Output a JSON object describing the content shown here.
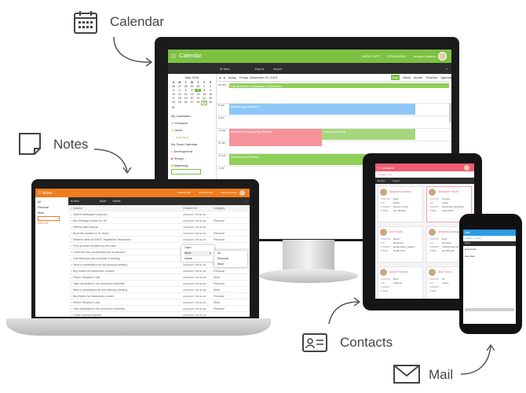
{
  "labels": {
    "calendar": "Calendar",
    "notes": "Notes",
    "contacts": "Contacts",
    "mail": "Mail"
  },
  "colors": {
    "calendar": "#7cc142",
    "notes": "#f07c1e",
    "contacts": "#f25d72",
    "mail": "#2d9be6",
    "blue_event": "#8ec7f5",
    "red_event": "#f6939a"
  },
  "calendar": {
    "title": "Calendar",
    "about": "ABOUT APP",
    "download": "DOWNLOAD",
    "user": "Antonio Moreno",
    "toolbar": {
      "new": "New",
      "export": "Export",
      "import": "Import"
    },
    "month": "May 2015",
    "weekdays": [
      "S",
      "M",
      "T",
      "W",
      "T",
      "F",
      "S"
    ],
    "days": [
      "26",
      "27",
      "28",
      "29",
      "30",
      "1",
      "2",
      "3",
      "4",
      "5",
      "6",
      "7",
      "8",
      "9",
      "10",
      "11",
      "12",
      "13",
      "14",
      "15",
      "16",
      "17",
      "18",
      "19",
      "20",
      "21",
      "22",
      "23",
      "24",
      "25",
      "26",
      "27",
      "28",
      "29",
      "30",
      "31"
    ],
    "my_calendars": "My Calendars",
    "personal": "Personal",
    "work": "Work",
    "add_new": "Add New",
    "team_calendar": "My Team Calendar",
    "development": "Development",
    "design": "Design",
    "marketing": "Marketing",
    "today": "today",
    "date": "Friday, December 04, 2015",
    "views": [
      "Day",
      "Week",
      "Month",
      "Timeline",
      "Agenda"
    ],
    "allday": "all day",
    "hours": [
      "8 am",
      "9 am",
      "10 am",
      "11 am",
      "12 pm",
      "1 pm"
    ],
    "events": {
      "conf": "Visual Studio Integration Conference",
      "dentist": "Dentist Appointment",
      "review": "Review Ad Campaing Results",
      "planning": "Product Planing",
      "arch": "Architecture Review"
    }
  },
  "notes": {
    "title": "Notes",
    "about": "ABOUT APP",
    "download": "DOWNLOAD",
    "user": "Antonio Moreno",
    "toolbar": {
      "new": "New",
      "move": "Move",
      "delete": "Delete"
    },
    "filters": [
      "All",
      "Personal",
      "Work"
    ],
    "add_new": "Add new",
    "columns": [
      "Subject",
      "Created On",
      "Category"
    ],
    "rows": [
      [
        "Submit whitepaper proposal",
        "4/26/2015 7:58:40 AM",
        ""
      ],
      [
        "Buy birthday present for Jill",
        "4/26/2015 7:58:40 AM",
        "Personal"
      ],
      [
        "Weekly data backup",
        "4/26/2015 7:58:40 AM",
        ""
      ],
      [
        "Book ski vacation in St. Anton",
        "4/26/2015 7:58:40 AM",
        "Personal"
      ],
      [
        "Reserve table at WIKAY Vegetarian Restaurant",
        "4/26/2015 7:58:40 AM",
        "Personal"
      ],
      [
        "Pick up exam results from the clinic",
        "4/26/2015 7:58:40 AM",
        ""
      ],
      [
        "Order the new JavaScript book on Amazon",
        "4/26/2015 7:58:40 AM",
        ""
      ],
      [
        "Call attorneys and schedule a meeting",
        "4/26/2015 7:58:40 AM",
        "Work"
      ],
      [
        "Send a cancellation for the planning meeting",
        "4/26/2015 7:58:40 AM",
        "Work"
      ],
      [
        "Buy tickets for Madonna's concert",
        "4/26/2015 7:58:40 AM",
        "Personal"
      ],
      [
        "Return Simpson's call",
        "4/26/2015 7:58:40 AM",
        "Work"
      ],
      [
        "Take Samantha to the annual art exhibition",
        "4/26/2015 7:58:40 AM",
        "Personal"
      ],
      [
        "Send a cancellation for the planning meeting",
        "4/26/2015 7:58:40 AM",
        "Work"
      ],
      [
        "Buy tickets for Madonna's concert",
        "4/26/2015 7:58:40 AM",
        "Personal"
      ],
      [
        "Return Simpson's call",
        "4/26/2015 7:58:40 AM",
        "Work"
      ],
      [
        "Take Samantha to the annual art exhibition",
        "4/26/2015 7:58:40 AM",
        "Personal"
      ],
      [
        "Check account balance",
        "4/26/2015 7:58:40 AM",
        ""
      ]
    ],
    "context_menu": [
      "Open",
      "Move",
      "Delete"
    ],
    "submenu": [
      "All",
      "Personal",
      "Work"
    ]
  },
  "contacts": {
    "title": "Contacts",
    "breadcrumb": "Groups > All",
    "toolbar": {
      "new": "New",
      "export": "Export"
    },
    "fields": [
      "COUNTRY",
      "CITY",
      "COMPANY",
      "PHONE"
    ],
    "cards": [
      {
        "name": "Alejandra Camino",
        "values": [
          "Spain",
          "Madrid",
          "Romero y tomillo",
          "(91) 745 6200"
        ]
      },
      {
        "name": "Alexander Feuer",
        "values": [
          "Germany",
          "Leipzig",
          "Morgenstern Gesundkost",
          "0342-023176"
        ]
      },
      {
        "name": "Ana Trujillo",
        "values": [
          "Mexico",
          "México D.F.",
          "Emparedados y helados",
          "(5) 555-4729"
        ]
      },
      {
        "name": "Anabela Domingues",
        "values": [
          "Brazil",
          "Sao Paulo",
          "Tradição Hipermercados",
          "(11) 555-2167"
        ]
      },
      {
        "name": "André Fonseca",
        "values": [
          "Brazil",
          "Campinas",
          "",
          ""
        ]
      },
      {
        "name": "Ann Devon",
        "values": [
          "UK",
          "London",
          "",
          ""
        ]
      }
    ]
  },
  "mail": {
    "title": "Mail",
    "breadcrumb": "Folders > Inbox",
    "compose": "New Email",
    "body": "New Mail",
    "send": "Send"
  }
}
